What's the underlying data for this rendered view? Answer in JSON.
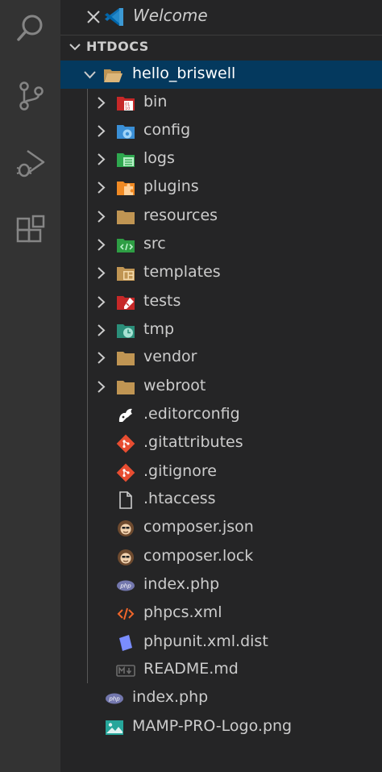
{
  "activity_bar": {
    "icons": [
      "search-icon",
      "source-control-icon",
      "run-debug-icon",
      "extensions-icon"
    ]
  },
  "open_editors": {
    "items": [
      {
        "label": "Welcome",
        "icon": "vscode-logo-icon"
      }
    ]
  },
  "explorer": {
    "section_title": "HTDOCS",
    "root_folder": {
      "label": "hello_briswell",
      "expanded": true
    },
    "folders": [
      {
        "label": "bin",
        "icon": "bin-folder-icon",
        "color": "#c62828"
      },
      {
        "label": "config",
        "icon": "config-folder-icon",
        "color": "#3a8fd6"
      },
      {
        "label": "logs",
        "icon": "logs-folder-icon",
        "color": "#2fa84f"
      },
      {
        "label": "plugins",
        "icon": "plugins-folder-icon",
        "color": "#f08a24"
      },
      {
        "label": "resources",
        "icon": "folder-icon",
        "color": "#c09553"
      },
      {
        "label": "src",
        "icon": "src-folder-icon",
        "color": "#2e9e44"
      },
      {
        "label": "templates",
        "icon": "templates-folder-icon",
        "color": "#c09553"
      },
      {
        "label": "tests",
        "icon": "tests-folder-icon",
        "color": "#c62828"
      },
      {
        "label": "tmp",
        "icon": "tmp-folder-icon",
        "color": "#2b8f7a"
      },
      {
        "label": "vendor",
        "icon": "folder-icon",
        "color": "#c09553"
      },
      {
        "label": "webroot",
        "icon": "folder-icon",
        "color": "#c09553"
      }
    ],
    "files": [
      {
        "label": ".editorconfig",
        "icon": "editorconfig-icon"
      },
      {
        "label": ".gitattributes",
        "icon": "git-icon"
      },
      {
        "label": ".gitignore",
        "icon": "git-icon"
      },
      {
        "label": ".htaccess",
        "icon": "file-icon"
      },
      {
        "label": "composer.json",
        "icon": "composer-icon"
      },
      {
        "label": "composer.lock",
        "icon": "composer-icon"
      },
      {
        "label": "index.php",
        "icon": "php-icon"
      },
      {
        "label": "phpcs.xml",
        "icon": "xml-icon"
      },
      {
        "label": "phpunit.xml.dist",
        "icon": "phpunit-icon"
      },
      {
        "label": "README.md",
        "icon": "markdown-icon"
      }
    ],
    "root_files": [
      {
        "label": "index.php",
        "icon": "php-icon"
      },
      {
        "label": "MAMP-PRO-Logo.png",
        "icon": "image-icon"
      }
    ]
  }
}
